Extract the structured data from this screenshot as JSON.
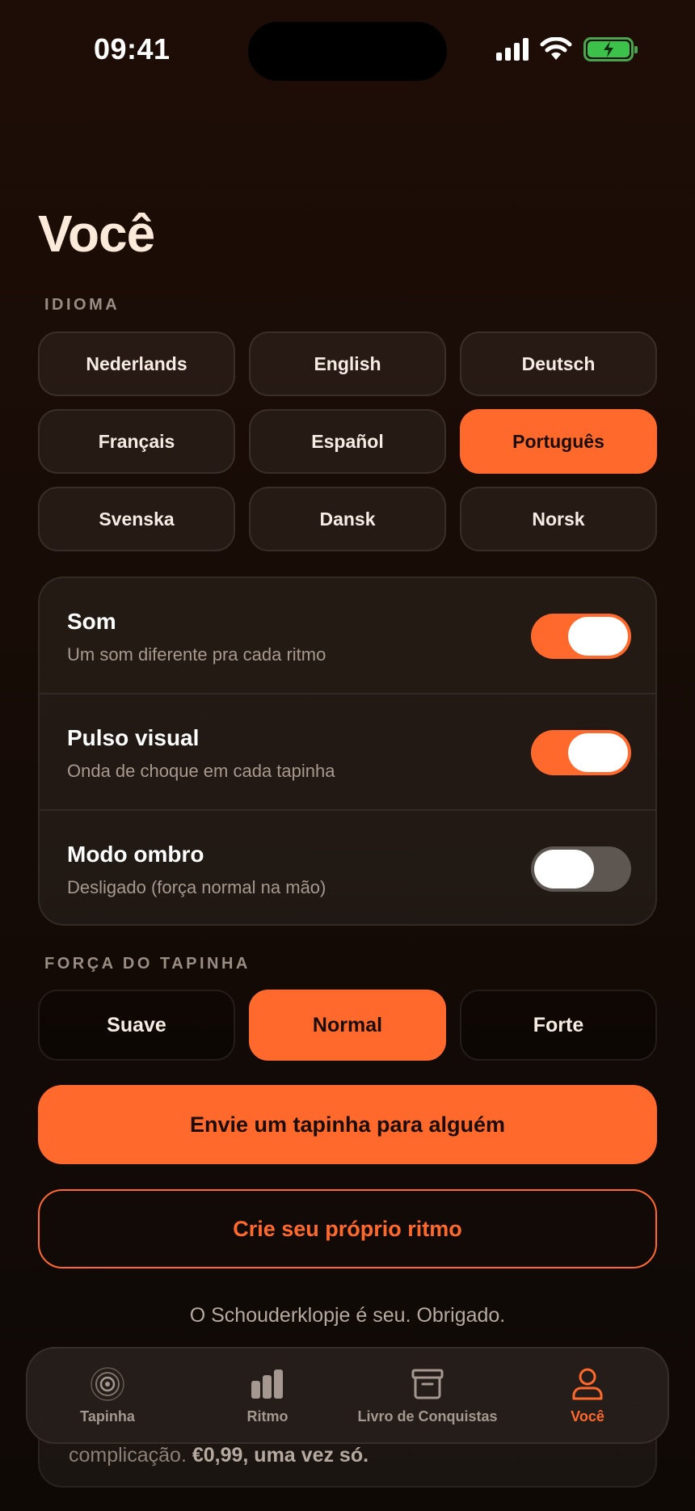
{
  "status_bar": {
    "time": "09:41"
  },
  "page": {
    "title": "Você"
  },
  "language_section": {
    "label": "IDIOMA",
    "options": [
      {
        "label": "Nederlands",
        "selected": false
      },
      {
        "label": "English",
        "selected": false
      },
      {
        "label": "Deutsch",
        "selected": false
      },
      {
        "label": "Français",
        "selected": false
      },
      {
        "label": "Español",
        "selected": false
      },
      {
        "label": "Português",
        "selected": true
      },
      {
        "label": "Svenska",
        "selected": false
      },
      {
        "label": "Dansk",
        "selected": false
      },
      {
        "label": "Norsk",
        "selected": false
      }
    ]
  },
  "settings": [
    {
      "title": "Som",
      "subtitle": "Um som diferente pra cada ritmo",
      "on": true
    },
    {
      "title": "Pulso visual",
      "subtitle": "Onda de choque em cada tapinha",
      "on": true
    },
    {
      "title": "Modo ombro",
      "subtitle": "Desligado (força normal na mão)",
      "on": false
    }
  ],
  "force_section": {
    "label": "FORÇA DO TAPINHA",
    "options": [
      {
        "label": "Suave",
        "selected": false
      },
      {
        "label": "Normal",
        "selected": true
      },
      {
        "label": "Forte",
        "selected": false
      }
    ]
  },
  "actions": {
    "send_label": "Envie um tapinha para alguém",
    "create_label": "Crie seu próprio ritmo"
  },
  "thanks_text": "O Schouderklopje é seu. Obrigado.",
  "hidden_card": {
    "text_prefix": "complicação. ",
    "text_bold": "€0,99, uma vez só."
  },
  "tabs": [
    {
      "label": "Tapinha",
      "icon": "target-icon",
      "active": false
    },
    {
      "label": "Ritmo",
      "icon": "bars-icon",
      "active": false
    },
    {
      "label": "Livro de Conquistas",
      "icon": "archive-icon",
      "active": false
    },
    {
      "label": "Você",
      "icon": "person-icon",
      "active": true
    }
  ],
  "colors": {
    "accent": "#ff6a2c",
    "background": "#180c06",
    "title": "#fbe9da"
  }
}
